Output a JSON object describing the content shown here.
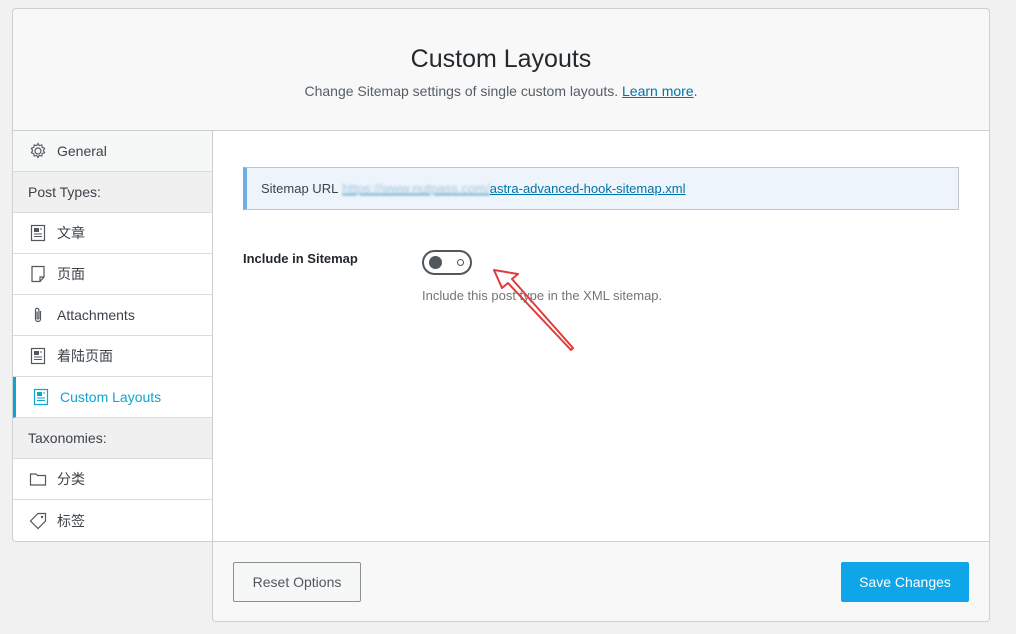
{
  "header": {
    "title": "Custom Layouts",
    "subtitle": "Change Sitemap settings of single custom layouts.",
    "learn_more": "Learn more",
    "subtitle_end": "."
  },
  "sidebar": {
    "general": "General",
    "post_types_heading": "Post Types:",
    "post_types": [
      {
        "label": "文章",
        "icon": "post-icon"
      },
      {
        "label": "页面",
        "icon": "page-icon"
      },
      {
        "label": "Attachments",
        "icon": "paperclip-icon"
      },
      {
        "label": "着陆页面",
        "icon": "post-icon"
      },
      {
        "label": "Custom Layouts",
        "icon": "layout-icon",
        "active": true
      }
    ],
    "taxonomies_heading": "Taxonomies:",
    "taxonomies": [
      {
        "label": "分类",
        "icon": "folder-icon"
      },
      {
        "label": "标签",
        "icon": "tag-icon"
      }
    ]
  },
  "notice": {
    "label": "Sitemap URL",
    "url_blurred": "https://www.nutpass.com/",
    "url_visible": "astra-advanced-hook-sitemap.xml"
  },
  "setting": {
    "label": "Include in Sitemap",
    "enabled": false,
    "description": "Include this post type in the XML sitemap."
  },
  "footer": {
    "reset_label": "Reset Options",
    "save_label": "Save Changes"
  },
  "colors": {
    "accent": "#0ea5e9",
    "active_text": "#0ea5cf",
    "annotation_arrow": "#e03a3a"
  }
}
